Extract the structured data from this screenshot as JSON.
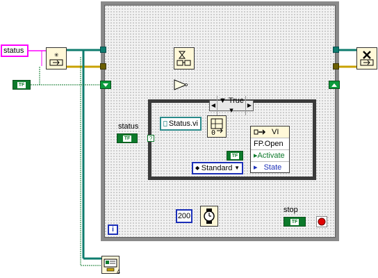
{
  "diagram": {
    "string_constant": "status",
    "loop_frame": {
      "iteration_label": "i"
    },
    "case_structure": {
      "selector_value": "True"
    },
    "status_indicator_label": "status",
    "stop_label": "stop",
    "vi_path_constant": "Status.vi",
    "property_node": {
      "header": "VI",
      "method": "FP.Open",
      "activate_label": "Activate",
      "state_label": "State"
    },
    "state_enum_value": "Standard",
    "wait_ms_constant": "200",
    "bool_const_label": "TF",
    "error_index": "4",
    "colors": {
      "string_wire": "#ff00ff",
      "boolean_wire": "#0d7a2b",
      "reference_wire": "#0e7c6e",
      "error_wire": "#c8a200",
      "numeric_wire": "#1b2fb8",
      "loop_border": "#8a8a8a"
    }
  }
}
